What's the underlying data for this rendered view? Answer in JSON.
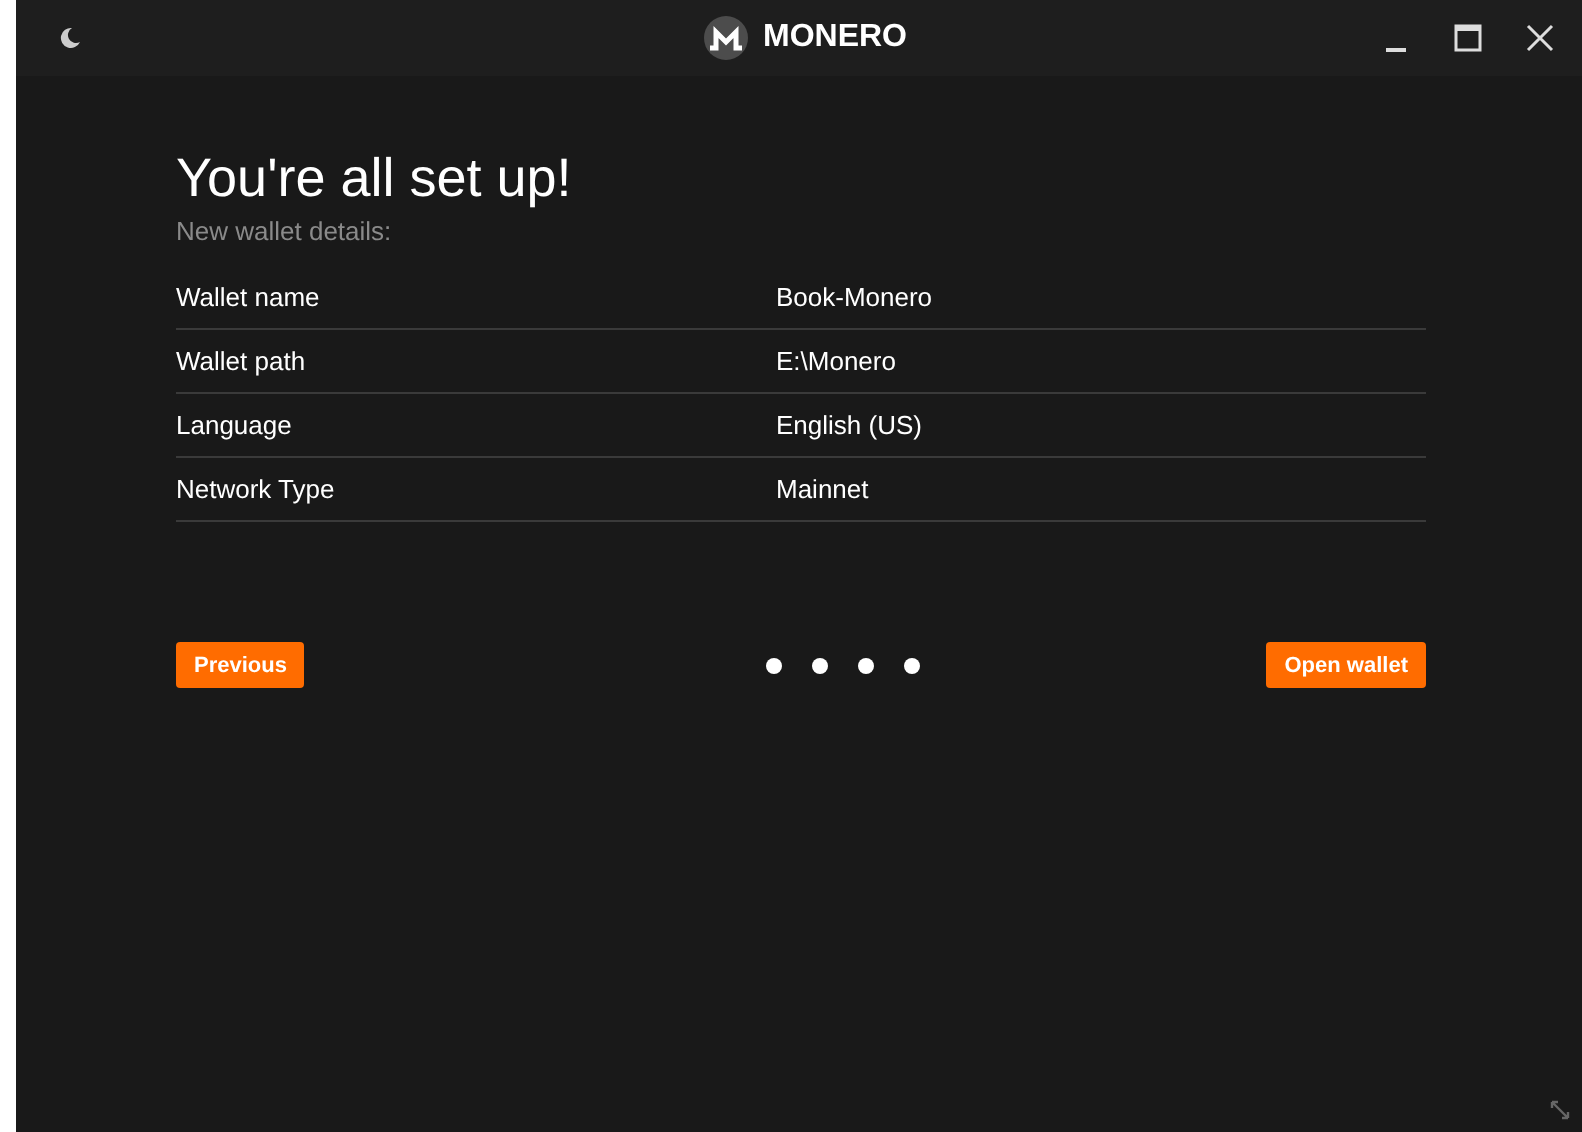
{
  "window": {
    "title": "MONERO"
  },
  "heading": "You're all set up!",
  "subheading": "New wallet details:",
  "details": [
    {
      "label": "Wallet name",
      "value": "Book-Monero"
    },
    {
      "label": "Wallet path",
      "value": "E:\\Monero"
    },
    {
      "label": "Language",
      "value": "English (US)"
    },
    {
      "label": "Network Type",
      "value": "Mainnet"
    }
  ],
  "buttons": {
    "previous": "Previous",
    "next": "Open wallet"
  }
}
